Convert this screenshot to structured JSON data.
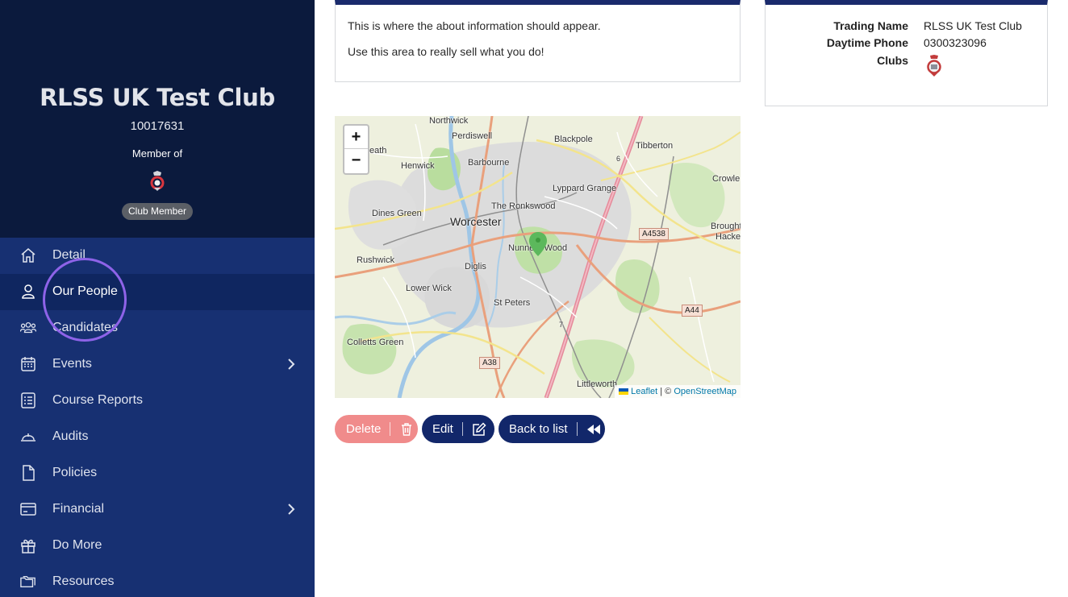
{
  "profile": {
    "club_name": "RLSS UK Test Club",
    "club_number": "10017631",
    "member_of_label": "Member of",
    "badge": "Club Member"
  },
  "nav": [
    {
      "label": "Detail",
      "icon": "home-icon",
      "has_chevron": false
    },
    {
      "label": "Our People",
      "icon": "person-icon",
      "has_chevron": false,
      "active": true
    },
    {
      "label": "Candidates",
      "icon": "group-icon",
      "has_chevron": false
    },
    {
      "label": "Events",
      "icon": "calendar-icon",
      "has_chevron": true
    },
    {
      "label": "Course Reports",
      "icon": "checklist-icon",
      "has_chevron": false
    },
    {
      "label": "Audits",
      "icon": "hardhat-icon",
      "has_chevron": false
    },
    {
      "label": "Policies",
      "icon": "document-icon",
      "has_chevron": false
    },
    {
      "label": "Financial",
      "icon": "credit-card-icon",
      "has_chevron": true
    },
    {
      "label": "Do More",
      "icon": "gift-icon",
      "has_chevron": false
    },
    {
      "label": "Resources",
      "icon": "folder-icon",
      "has_chevron": false
    }
  ],
  "about": {
    "line1": "This is where the about information should appear.",
    "line2": "Use this area to really sell what you do!"
  },
  "info": {
    "trading_name_label": "Trading Name",
    "trading_name_value": "RLSS UK Test Club",
    "daytime_phone_label": "Daytime Phone",
    "daytime_phone_value": "0300323096",
    "clubs_label": "Clubs"
  },
  "map": {
    "zoom_in": "+",
    "zoom_out": "−",
    "attribution_leaflet": "Leaflet",
    "attribution_sep": " | © ",
    "attribution_osm": "OpenStreetMap",
    "places": {
      "northwick": "Northwick",
      "perdiswell": "Perdiswell",
      "blackpole": "Blackpole",
      "tibberton": "Tibberton",
      "heath": "eath",
      "henwick": "Henwick",
      "barbourne": "Barbourne",
      "crowle": "Crowle",
      "lyppard_grange": "Lyppard Grange",
      "the_ronkswood": "The Ronkswood",
      "dines_green": "Dines Green",
      "worcester": "Worcester",
      "brought": "Brought",
      "hacke": "Hacke",
      "rushwick": "Rushwick",
      "nunnery_wood": "Nunnery Wood",
      "diglis": "Diglis",
      "lower_wick": "Lower Wick",
      "st_peters": "St Peters",
      "colletts_green": "Colletts Green",
      "littleworth": "Littleworth"
    },
    "roads": {
      "a4538": "A4538",
      "a44": "A44",
      "a38": "A38",
      "j6": "6",
      "j7": "7"
    }
  },
  "actions": {
    "delete": "Delete",
    "edit": "Edit",
    "back": "Back to list"
  },
  "colors": {
    "sidebar": "#173072",
    "sidebar_header": "#0b1a3d",
    "accent_ring": "#8e63e8",
    "primary_button": "#12276a",
    "danger_button": "#f08b8b"
  }
}
